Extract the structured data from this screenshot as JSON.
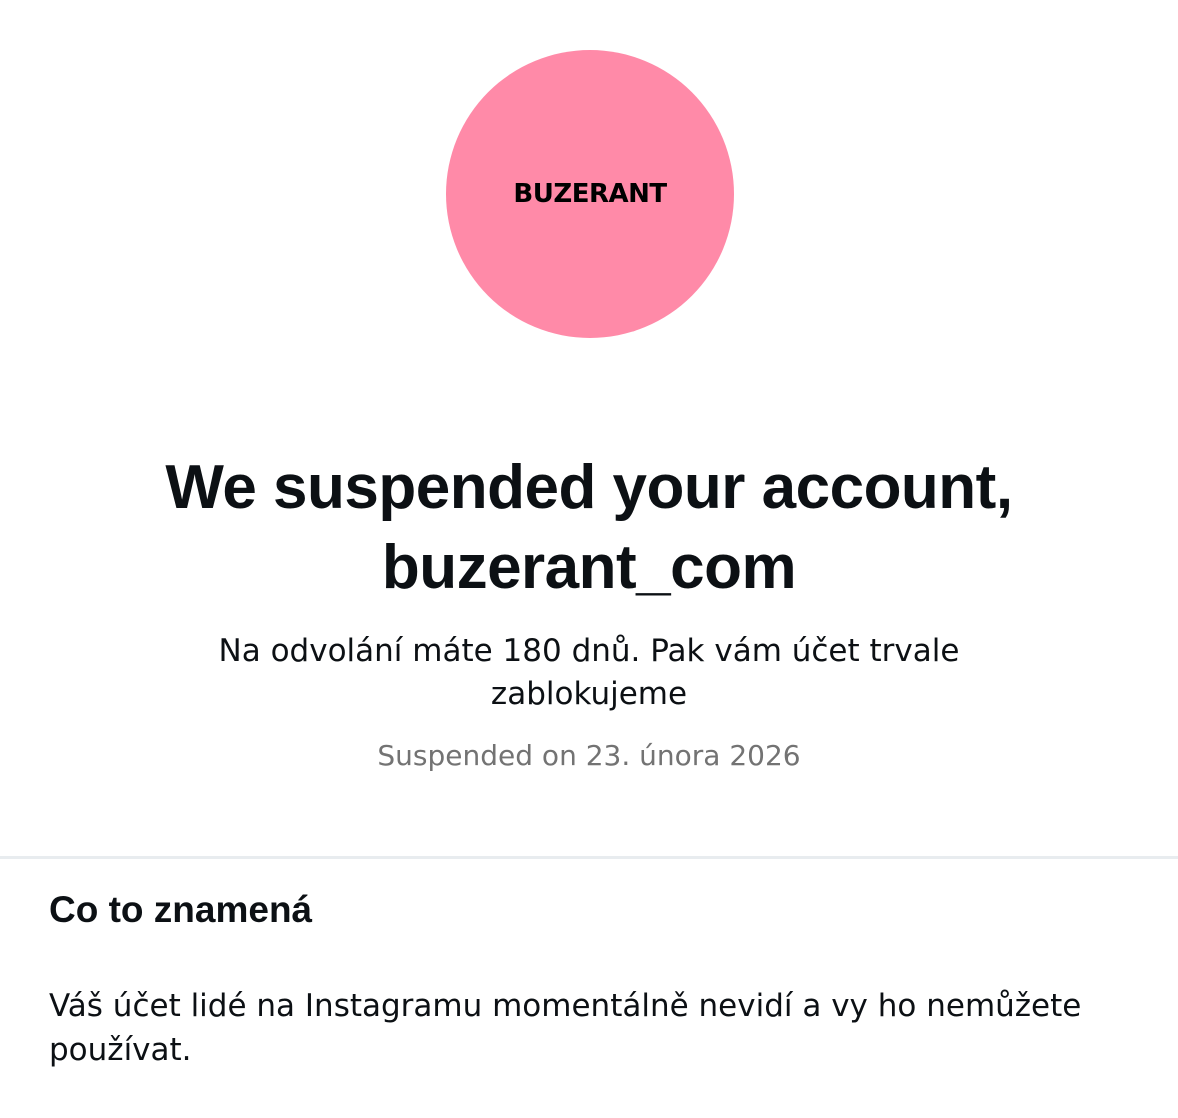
{
  "profile": {
    "avatar_text": "BUZERANT",
    "avatar_color": "#ff8aa8"
  },
  "suspension": {
    "title": "We suspended your account, buzerant_com",
    "appeal_text": "Na odvolání máte 180 dnů. Pak vám účet trvale zablokujeme",
    "date_text": "Suspended on 23. února 2026"
  },
  "info_section": {
    "title": "Co to znamená",
    "body": "Váš účet lidé na Instagramu momentálně nevidí a vy ho nemůžete používat."
  },
  "colors": {
    "text_primary": "#0c1014",
    "text_secondary": "#737373",
    "divider": "#e8ecef"
  }
}
